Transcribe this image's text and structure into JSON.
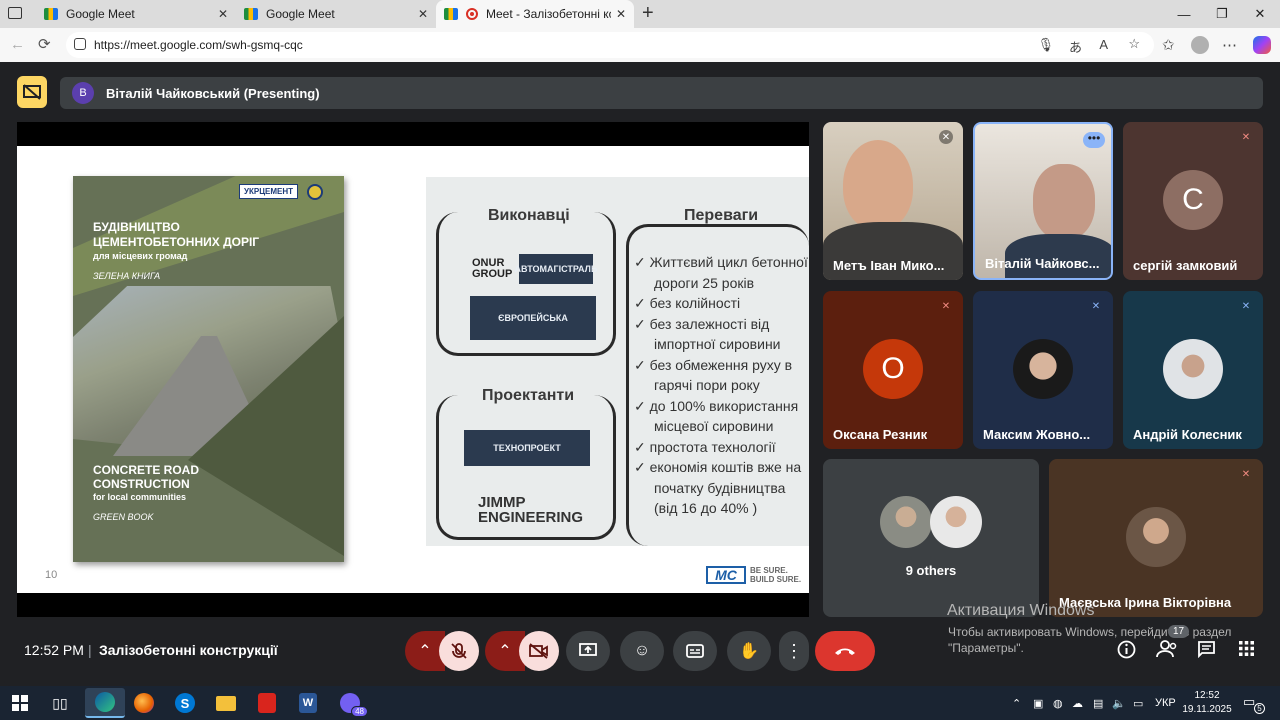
{
  "browser": {
    "tabs": [
      {
        "label": "Google Meet",
        "close": "✕"
      },
      {
        "label": "Google Meet",
        "close": "✕"
      },
      {
        "label": "Meet - Залізобетонні констр",
        "close": "✕"
      }
    ],
    "new_tab": "+",
    "url": "https://meet.google.com/swh-gsmq-cqc",
    "back": "←",
    "reload": "⟳"
  },
  "meeting": {
    "presenter_initial": "В",
    "presenter_label": "Віталій Чайковський (Presenting)",
    "time": "12:52 PM",
    "separator": "|",
    "title": "Залізобетонні конструкції",
    "participants_badge": "17"
  },
  "slide": {
    "page_number": "10",
    "book": {
      "publisher": "УКРЦЕМЕНТ",
      "title_ua": "БУДІВНИЦТВО ЦЕМЕНТОБЕТОННИХ ДОРІГ",
      "subtitle_ua": "для місцевих громад",
      "series_ua": "ЗЕЛЕНА КНИГА",
      "title_en": "CONCRETE ROAD CONSTRUCTION",
      "subtitle_en": "for local communities",
      "series_en": "GREEN BOOK"
    },
    "board": {
      "contractors_header": "Виконавці",
      "designers_header": "Проектанти",
      "advantages_header": "Переваги",
      "logos": [
        "ONUR GROUP",
        "АВТОМАГІСТРАЛЬ",
        "ЄВРОПЕЙСЬКА",
        "ТЕХНОПРОЕКТ",
        "JIMMP ENGINEERING"
      ],
      "advantages": [
        "✓ Життєвий цикл бетонної",
        "  дороги 25 років",
        "✓ без колійності",
        "✓ без залежності від",
        "  імпортної сировини",
        "✓ без обмеження руху в",
        "  гарячі пори року",
        "✓ до 100% використання",
        "  місцевої сировини",
        "✓ простота технології",
        "✓ економія коштів вже на",
        "  початку будівництва",
        "  (від 16 до 40% )"
      ]
    },
    "mc_logo": "MC",
    "mc_tagline_1": "BE SURE.",
    "mc_tagline_2": "BUILD SURE."
  },
  "participants": [
    {
      "name": "Метъ Іван Мико...",
      "muted": true
    },
    {
      "name": "Віталій Чайковс...",
      "muted": false
    },
    {
      "name": "сергій замковий",
      "initial": "С",
      "muted": true
    },
    {
      "name": "Оксана Резник",
      "initial": "О",
      "muted": true
    },
    {
      "name": "Максим Жовно...",
      "muted": true
    },
    {
      "name": "Андрій Колесник",
      "muted": true
    },
    {
      "name": "9 others"
    },
    {
      "name": "Маєвська Ірина Вікторівна",
      "muted": true
    }
  ],
  "watermark": {
    "line1": "Активация Windows",
    "line2": "Чтобы активировать Windows, перейдите в раздел \"Параметры\"."
  },
  "taskbar": {
    "lang": "УКР",
    "time": "12:52",
    "date": "19.11.2025",
    "viber_badge": "48",
    "notif_count": "5"
  },
  "colors": {
    "meet_bg": "#202124",
    "tile_bg": "#3c4043",
    "hangup": "#dc362e",
    "muted_red": "#8c1d18",
    "present_yellow": "#fdd663"
  }
}
